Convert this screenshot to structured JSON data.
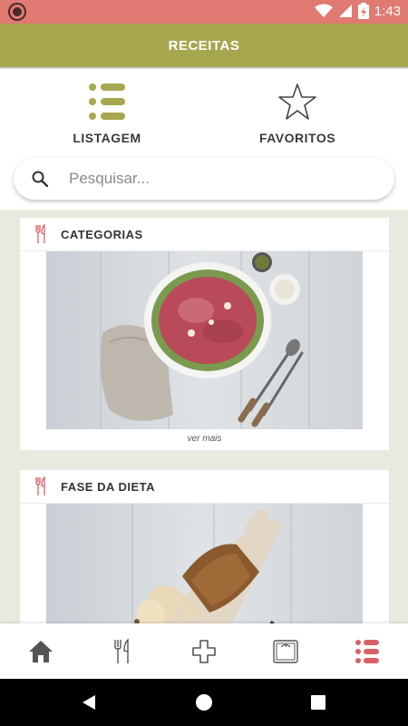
{
  "status_bar": {
    "time": "1:43",
    "icons": [
      "record-icon",
      "wifi-icon",
      "signal-icon",
      "battery-icon"
    ]
  },
  "app_bar": {
    "title": "RECEITAS",
    "color": "#a6a74f"
  },
  "tabs": [
    {
      "label": "LISTAGEM",
      "icon": "list-icon",
      "active": true
    },
    {
      "label": "FAVORITOS",
      "icon": "star-icon",
      "active": false
    }
  ],
  "search": {
    "placeholder": "Pesquisar...",
    "value": ""
  },
  "cards": [
    {
      "title": "CATEGORIAS",
      "footer": "ver mais",
      "image": "carpaccio-photo"
    },
    {
      "title": "FASE DA DIETA",
      "image": "bread-photo"
    }
  ],
  "bottom_nav": [
    {
      "name": "home",
      "icon": "home-icon"
    },
    {
      "name": "recipes",
      "icon": "cutlery-icon"
    },
    {
      "name": "add",
      "icon": "plus-icon"
    },
    {
      "name": "scale",
      "icon": "scale-icon"
    },
    {
      "name": "list",
      "icon": "list-icon",
      "active": true
    }
  ],
  "colors": {
    "accent": "#a6a74f",
    "active_nav": "#d9606a",
    "status_bar": "#e07a72"
  }
}
